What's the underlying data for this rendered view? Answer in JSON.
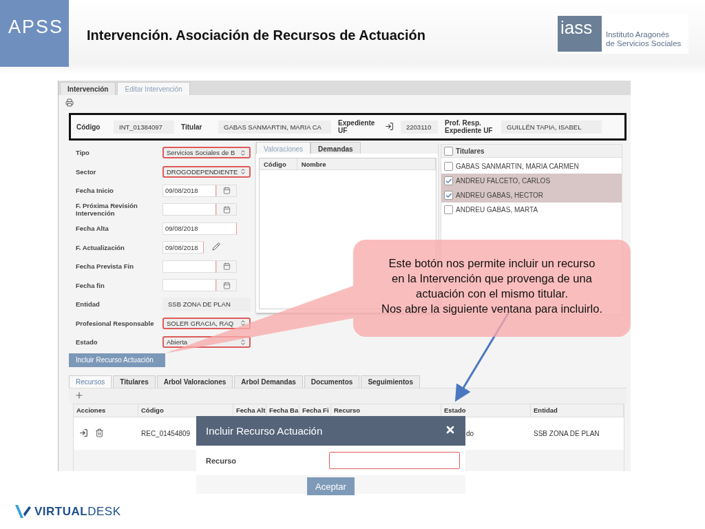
{
  "slide": {
    "badge": "APSS",
    "title": "Intervención. Asociación de Recursos de Actuación",
    "logo": {
      "mark": "iass",
      "lines": [
        "Instituto Aragonés",
        "de Servicios Sociales"
      ]
    }
  },
  "app": {
    "tabs": [
      {
        "label": "Intervención",
        "selected": false
      },
      {
        "label": "Editar Intervención",
        "selected": true
      }
    ],
    "summary": [
      {
        "label": "Código",
        "value": "INT_01384097",
        "kind": "text"
      },
      {
        "label": "Titular",
        "value": "GABAS SANMARTIN, MARIA CA",
        "kind": "text"
      },
      {
        "label": "Expediente UF",
        "value": "2203110",
        "kind": "link"
      },
      {
        "label": "Prof. Resp. Expediente UF",
        "value": "GUILLÉN TAPIA, ISABEL",
        "kind": "text"
      }
    ],
    "form": [
      {
        "label": "Tipo",
        "value": "Servicios Sociales de B",
        "kind": "select"
      },
      {
        "label": "Sector",
        "value": "DROGODEPENDIENTE",
        "kind": "select"
      },
      {
        "label": "Fecha Inicio",
        "value": "09/08/2018",
        "kind": "date"
      },
      {
        "label": "F. Próxima Revisión Intervención",
        "kind": "date"
      },
      {
        "label": "Fecha Alta",
        "value": "09/08/2018",
        "kind": "text"
      },
      {
        "label": "F. Actualización",
        "value": "09/08/2018",
        "kind": "edit"
      },
      {
        "label": "Fecha Prevista Fin",
        "kind": "date"
      },
      {
        "label": "Fecha fin",
        "kind": "date"
      },
      {
        "label": "Entidad",
        "value": "SSB ZONA DE PLAN",
        "kind": "plain"
      },
      {
        "label": "Profesional Responsable",
        "value": "SOLER GRACIA, RAQ",
        "kind": "select"
      },
      {
        "label": "Estado",
        "value": "Abierta",
        "kind": "select"
      }
    ],
    "action_button": "Incluir Recurso Actuación",
    "middle": {
      "tabs": [
        {
          "label": "Valoraciones",
          "selected": true
        },
        {
          "label": "Demandas",
          "selected": false
        }
      ],
      "columns": [
        "Código",
        "Nombre"
      ]
    },
    "titulares": {
      "header": "Titulares",
      "checked": false,
      "rows": [
        {
          "name": "GABAS SANMARTIN, MARIA CARMEN",
          "checked": false
        },
        {
          "name": "ANDREU FALCETO, CARLOS",
          "checked": true
        },
        {
          "name": "ANDREU GABAS, HECTOR",
          "checked": true
        },
        {
          "name": "ANDREU GABAS, MARTA",
          "checked": false
        }
      ]
    },
    "bottom": {
      "tabs": [
        {
          "label": "Recursos",
          "selected": true
        },
        {
          "label": "Titulares",
          "selected": false
        },
        {
          "label": "Arbol Valoraciones",
          "selected": false
        },
        {
          "label": "Arbol Demandas",
          "selected": false
        },
        {
          "label": "Documentos",
          "selected": false
        },
        {
          "label": "Seguimientos",
          "selected": false
        }
      ],
      "columns": [
        "Acciones",
        "Código",
        "Fecha Alt",
        "Fecha Ba",
        "Fecha Fi",
        "Recurso",
        "Estado",
        "Entidad"
      ],
      "rows": [
        {
          "codigo": "REC_01454809",
          "estado": "do",
          "entidad": "SSB ZONA DE PLAN"
        }
      ]
    }
  },
  "callout": {
    "lines": [
      "Este botón nos permite incluir un recurso",
      "en la Intervención que provenga de una",
      "actuación con el mismo titular.",
      "Nos abre la siguiente ventana para incluirlo."
    ]
  },
  "modal": {
    "title": "Incluir Recurso Actuación",
    "field_label": "Recurso",
    "button": "Aceptar"
  },
  "footer": {
    "logo": "**VIRTUAL**DESK"
  }
}
